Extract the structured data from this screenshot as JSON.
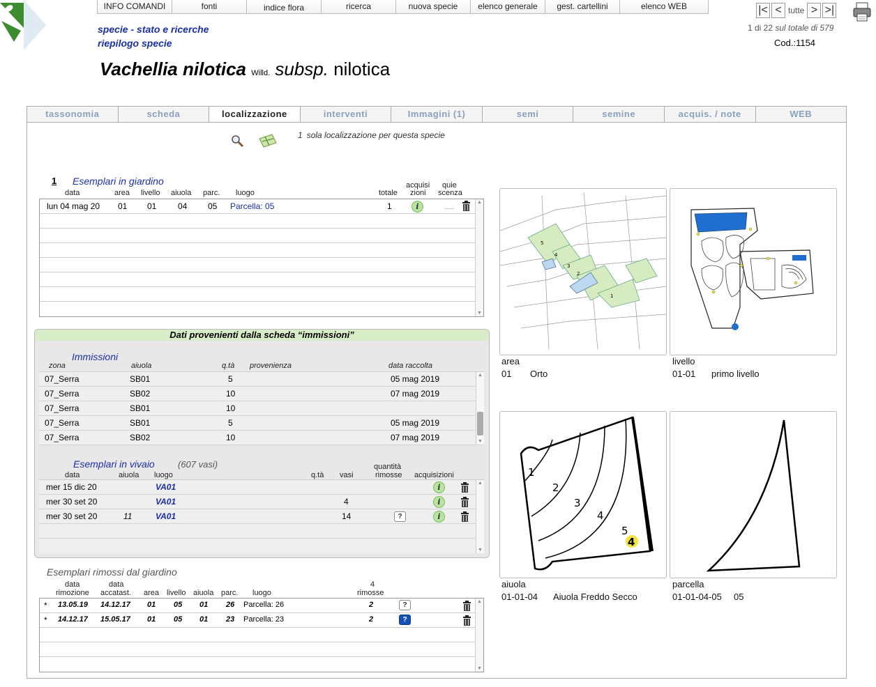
{
  "top_menu": [
    "INFO COMANDI",
    "fonti",
    "indice flora",
    "ricerca",
    "nuova specie",
    "elenco generale",
    "gest. cartellini",
    "elenco WEB"
  ],
  "subtitle1": "specie - stato e ricerche",
  "subtitle2": "riepilogo specie",
  "species": {
    "genus_species": "Vachellia nilotica",
    "author": "Willd.",
    "rank": "subsp.",
    "infra": "nilotica"
  },
  "nav": {
    "first": "|<",
    "prev": "<",
    "all": "tutte",
    "next": ">",
    "last": ">|",
    "pos": "1 di 22",
    "total_label": "sul totale di 579",
    "code": "Cod.:1154"
  },
  "tabs": [
    "tassonomia",
    "scheda",
    "localizzazione",
    "interventi",
    "Immagini (1)",
    "semi",
    "semine",
    "acquis. / note",
    "WEB"
  ],
  "active_tab": "localizzazione",
  "loc_count": "1",
  "loc_note": "sola localizzazione per questa specie",
  "garden": {
    "count": "1",
    "title": "Esemplari in giardino",
    "headers": {
      "data": "data",
      "area": "area",
      "livello": "livello",
      "aiuola": "aiuola",
      "parc": "parc.",
      "luogo": "luogo",
      "totale": "totale",
      "acq1": "acquisi",
      "acq2": "zioni",
      "qui1": "quie",
      "qui2": "scenza"
    },
    "rows": [
      {
        "data": "lun 04 mag 20",
        "area": "01",
        "livello": "01",
        "aiuola": "04",
        "parc": "05",
        "luogo": "Parcella: 05",
        "totale": "1"
      }
    ]
  },
  "immissioni": {
    "banner": "Dati provenienti dalla scheda “immissioni”",
    "title": "Immissioni",
    "headers": {
      "zona": "zona",
      "aiuola": "aiuola",
      "qta": "q.tà",
      "prov": "provenienza",
      "data": "data raccolta"
    },
    "rows": [
      {
        "zona": "07_Serra",
        "aiuola": "SB01",
        "qta": "5",
        "data": "05 mag 2019"
      },
      {
        "zona": "07_Serra",
        "aiuola": "SB02",
        "qta": "10",
        "data": "07 mag 2019"
      },
      {
        "zona": "07_Serra",
        "aiuola": "SB01",
        "qta": "10",
        "data": ""
      },
      {
        "zona": "07_Serra",
        "aiuola": "SB01",
        "qta": "5",
        "data": "05 mag 2019"
      },
      {
        "zona": "07_Serra",
        "aiuola": "SB02",
        "qta": "10",
        "data": "07 mag 2019"
      }
    ]
  },
  "vivaio": {
    "title": "Esemplari in vivaio",
    "count_note": "(607 vasi)",
    "headers": {
      "data": "data",
      "aiuola": "aiuola",
      "luogo": "luogo",
      "qta": "q.tà",
      "vasi": "vasi",
      "qr1": "quantità",
      "qr2": "rimosse",
      "acq": "acquisizioni"
    },
    "rows": [
      {
        "data": "mer 15 dic 20",
        "aiuola": "",
        "luogo": "VA01",
        "vasi": "",
        "q": false
      },
      {
        "data": "mer 30 set 20",
        "aiuola": "",
        "luogo": "VA01",
        "vasi": "4",
        "q": false
      },
      {
        "data": "mer 30 set 20",
        "aiuola": "11",
        "luogo": "VA01",
        "vasi": "14",
        "q": true
      }
    ]
  },
  "removed": {
    "title": "Esemplari rimossi dal giardino",
    "headers": {
      "d1a": "data",
      "d1b": "rimozione",
      "d2a": "data",
      "d2b": "accatast.",
      "area": "area",
      "livello": "livello",
      "aiuola": "aiuola",
      "parc": "parc.",
      "luogo": "luogo",
      "rim_count": "4",
      "rim": "rimosse"
    },
    "rows": [
      {
        "mark": "*",
        "rim": "13.05.19",
        "acc": "14.12.17",
        "area": "01",
        "livello": "05",
        "aiuola": "01",
        "parc": "26",
        "luogo": "Parcella: 26",
        "n": "2",
        "q": "plain"
      },
      {
        "mark": "*",
        "rim": "14.12.17",
        "acc": "15.05.17",
        "area": "01",
        "livello": "05",
        "aiuola": "01",
        "parc": "23",
        "luogo": "Parcella: 23",
        "n": "2",
        "q": "blue"
      }
    ]
  },
  "maps": {
    "area": {
      "label": "area",
      "code": "01",
      "name": "Orto"
    },
    "livello": {
      "label": "livello",
      "code": "01-01",
      "name": "primo livello"
    },
    "aiuola": {
      "label": "aiuola",
      "code": "01-01-04",
      "name": "Aiuola Freddo Secco"
    },
    "parcella": {
      "label": "parcella",
      "code": "01-01-04-05",
      "name": "05"
    },
    "aiuola_numbers": [
      "1",
      "2",
      "3",
      "4",
      "5",
      "4"
    ]
  },
  "colors": {
    "link": "#1a2fa8",
    "green_logo": "#3d8c2e",
    "info_green": "#b9e3a0",
    "highlight_yellow": "#f5e43a"
  }
}
